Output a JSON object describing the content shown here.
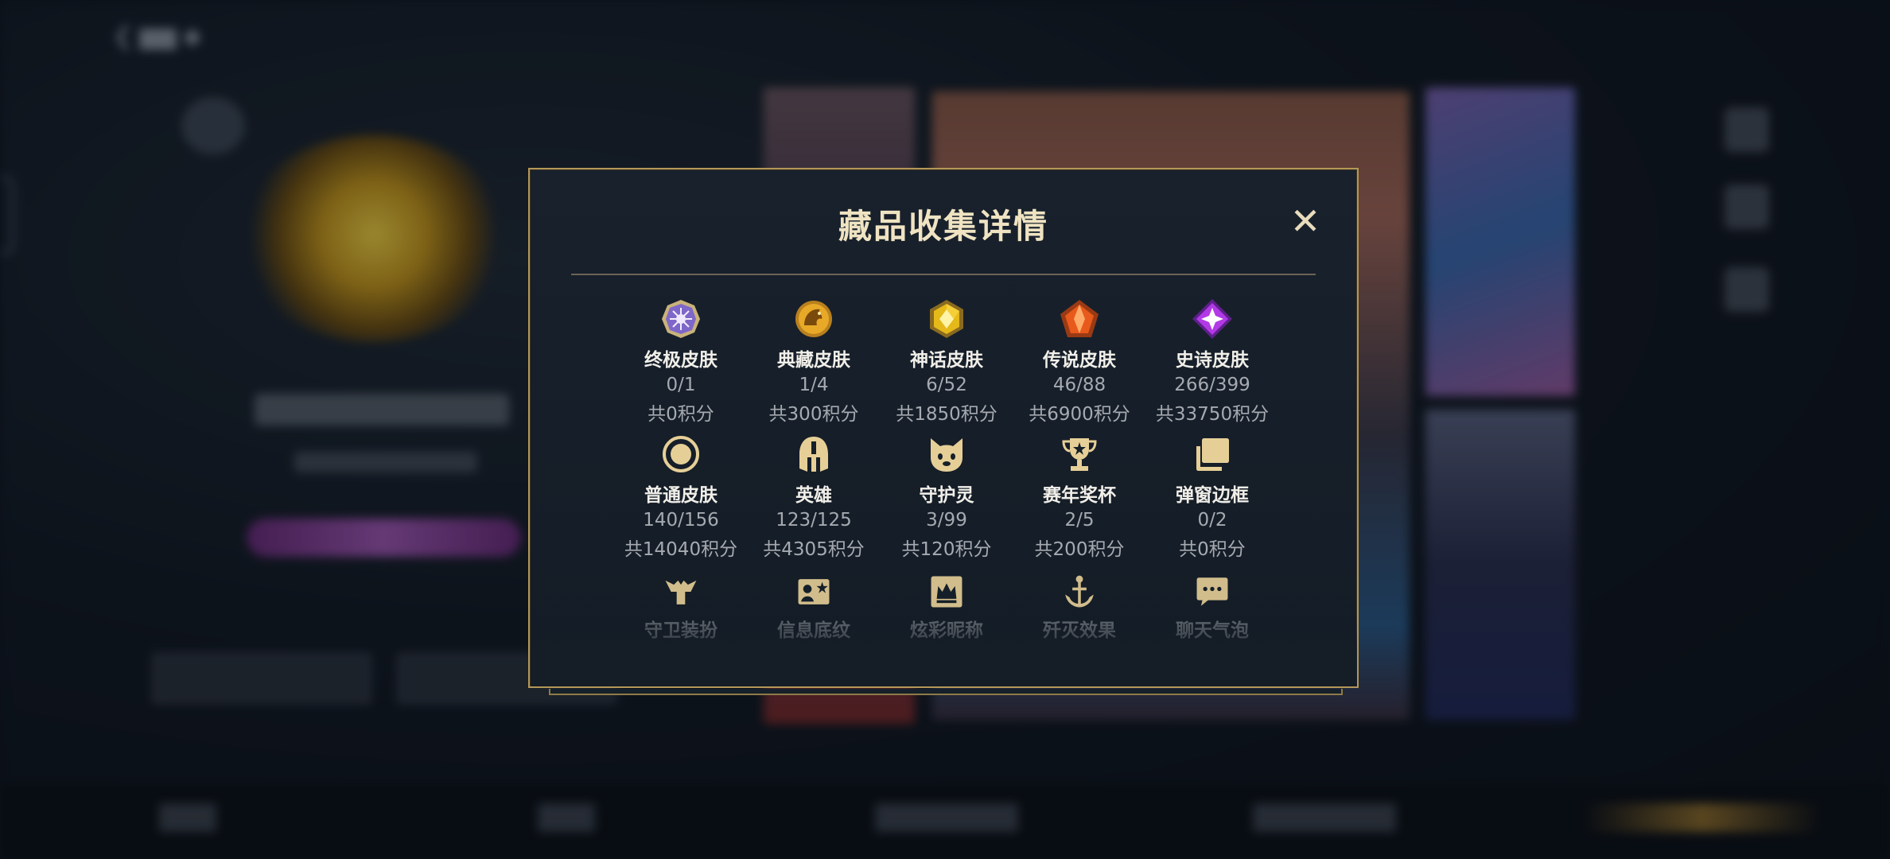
{
  "dialog": {
    "title": "藏品收集详情",
    "close_symbol": "✕",
    "items": [
      {
        "label": "终极皮肤",
        "count": "0/1",
        "points": "共0积分",
        "icon": "ultimate-skin-gem-icon"
      },
      {
        "label": "典藏皮肤",
        "count": "1/4",
        "points": "共300积分",
        "icon": "collection-skin-dragon-icon"
      },
      {
        "label": "神话皮肤",
        "count": "6/52",
        "points": "共1850积分",
        "icon": "myth-skin-gem-icon"
      },
      {
        "label": "传说皮肤",
        "count": "46/88",
        "points": "共6900积分",
        "icon": "legend-skin-gem-icon"
      },
      {
        "label": "史诗皮肤",
        "count": "266/399",
        "points": "共33750积分",
        "icon": "epic-skin-gem-icon"
      },
      {
        "label": "普通皮肤",
        "count": "140/156",
        "points": "共14040积分",
        "icon": "normal-skin-ring-icon"
      },
      {
        "label": "英雄",
        "count": "123/125",
        "points": "共4305积分",
        "icon": "hero-helmet-icon"
      },
      {
        "label": "守护灵",
        "count": "3/99",
        "points": "共120积分",
        "icon": "guardian-spirit-icon"
      },
      {
        "label": "赛年奖杯",
        "count": "2/5",
        "points": "共200积分",
        "icon": "season-trophy-icon"
      },
      {
        "label": "弹窗边框",
        "count": "0/2",
        "points": "共0积分",
        "icon": "popup-frame-icon"
      },
      {
        "label": "守卫装扮",
        "icon": "guard-outfit-icon"
      },
      {
        "label": "信息底纹",
        "icon": "info-background-icon"
      },
      {
        "label": "炫彩昵称",
        "icon": "colorful-nickname-icon"
      },
      {
        "label": "歼灭效果",
        "icon": "annihilation-effect-icon"
      },
      {
        "label": "聊天气泡",
        "icon": "chat-bubble-icon"
      }
    ]
  },
  "colors": {
    "border_gold": "#b49758",
    "title_text": "#efe3c2",
    "dialog_bg": "#18212c"
  }
}
